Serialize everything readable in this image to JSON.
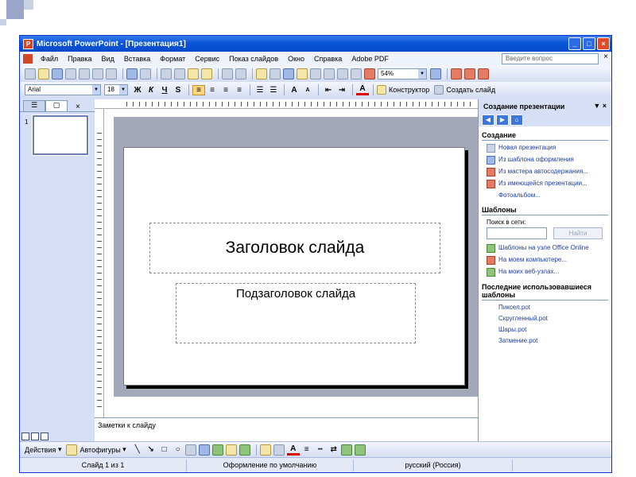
{
  "window": {
    "title": "Microsoft PowerPoint - [Презентация1]",
    "controls": [
      "_",
      "□",
      "×"
    ]
  },
  "menu": {
    "items": [
      "Файл",
      "Правка",
      "Вид",
      "Вставка",
      "Формат",
      "Сервис",
      "Показ слайдов",
      "Окно",
      "Справка",
      "Adobe PDF"
    ],
    "help_placeholder": "Введите вопрос",
    "close_glyph": "×"
  },
  "toolbar_standard": {
    "zoom": "54%"
  },
  "toolbar_format": {
    "font": "Arial",
    "size": "18",
    "bold": "Ж",
    "italic": "К",
    "underline": "Ч",
    "shadow": "S",
    "grow": "A",
    "shrink": "A",
    "color": "A",
    "designer": "Конструктор",
    "new_slide": "Создать слайд"
  },
  "slides_pane": {
    "tab_outline": "☰",
    "tab_slides": "▢",
    "close": "×",
    "slide_number": "1"
  },
  "slide": {
    "title": "Заголовок слайда",
    "subtitle": "Подзаголовок слайда"
  },
  "notes": {
    "text": "Заметки к слайду"
  },
  "task_pane": {
    "header": "Создание презентации",
    "controls": "▼ ×",
    "sections": {
      "create": {
        "title": "Создание",
        "links": [
          "Новая презентация",
          "Из шаблона оформления",
          "Из мастера автосодержания...",
          "Из имеющейся презентации...",
          "Фотоальбом..."
        ]
      },
      "templates": {
        "title": "Шаблоны",
        "search_label": "Поиск в сети:",
        "search_button": "Найти",
        "links": [
          "Шаблоны на узле Office Online",
          "На моем компьютере...",
          "На моих веб-узлах..."
        ]
      },
      "recent": {
        "title": "Последние использовавшиеся шаблоны",
        "links": [
          "Пиксел.pot",
          "Скругленный.pot",
          "Шары.pot",
          "Затмение.pot"
        ]
      }
    }
  },
  "drawing_toolbar": {
    "actions": "Действия",
    "autoshapes": "Автофигуры"
  },
  "statusbar": {
    "slide": "Слайд 1 из 1",
    "design": "Оформление по умолчанию",
    "language": "русский (Россия)"
  }
}
